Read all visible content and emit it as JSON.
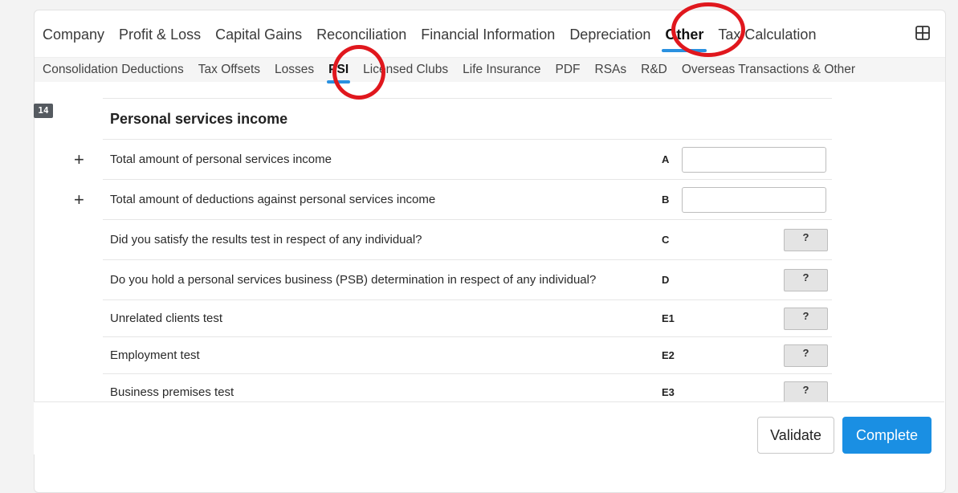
{
  "top_tabs": [
    {
      "label": "Company"
    },
    {
      "label": "Profit & Loss"
    },
    {
      "label": "Capital Gains"
    },
    {
      "label": "Reconciliation"
    },
    {
      "label": "Financial Information"
    },
    {
      "label": "Depreciation"
    },
    {
      "label": "Other",
      "active": true
    },
    {
      "label": "Tax Calculation"
    }
  ],
  "sub_tabs": [
    {
      "label": "Consolidation Deductions"
    },
    {
      "label": "Tax Offsets"
    },
    {
      "label": "Losses"
    },
    {
      "label": "PSI",
      "active": true
    },
    {
      "label": "Licensed Clubs"
    },
    {
      "label": "Life Insurance"
    },
    {
      "label": "PDF"
    },
    {
      "label": "RSAs"
    },
    {
      "label": "R&D"
    },
    {
      "label": "Overseas Transactions & Other"
    }
  ],
  "section": {
    "number": "14",
    "title": "Personal services income"
  },
  "rows": [
    {
      "label": "Total amount of personal services income",
      "code": "A",
      "control": "input",
      "value": "",
      "expandable": true
    },
    {
      "label": "Total amount of deductions against personal services income",
      "code": "B",
      "control": "input",
      "value": "",
      "expandable": true
    },
    {
      "label": "Did you satisfy the results test in respect of any individual?",
      "code": "C",
      "control": "choice",
      "value": "?"
    },
    {
      "label": "Do you hold a personal services business (PSB) determination in respect of any individual?",
      "code": "D",
      "control": "choice",
      "value": "?"
    },
    {
      "label": "Unrelated clients test",
      "code": "E1",
      "control": "choice",
      "value": "?"
    },
    {
      "label": "Employment test",
      "code": "E2",
      "control": "choice",
      "value": "?"
    },
    {
      "label": "Business premises test",
      "code": "E3",
      "control": "choice",
      "value": "?"
    }
  ],
  "plus_symbol": "+",
  "buttons": {
    "validate": "Validate",
    "complete": "Complete"
  },
  "colors": {
    "accent": "#2a91e0",
    "primary_button": "#1a8fe3",
    "annotation_circle": "#e0171d",
    "badge": "#555a60"
  },
  "icons": {
    "layout": "grid-layout-icon",
    "expand": "plus-icon"
  }
}
